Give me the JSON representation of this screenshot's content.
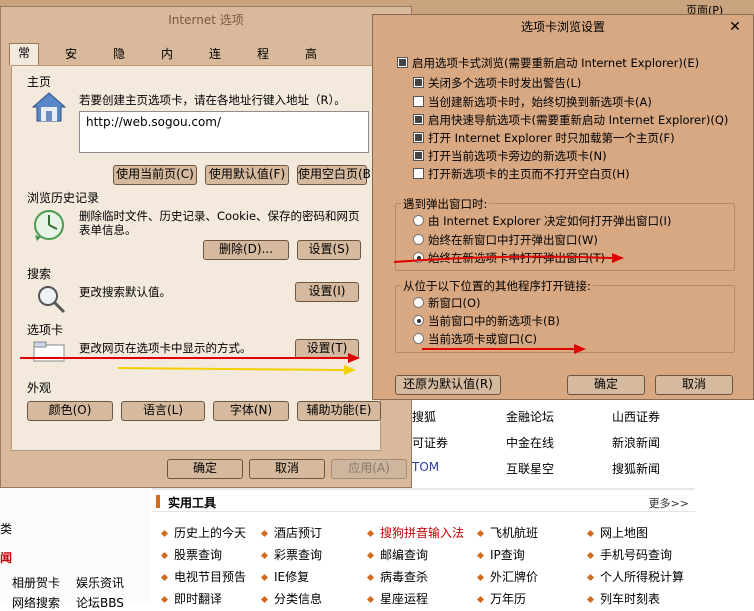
{
  "top_bar": {
    "page_label": "页面(P)"
  },
  "bg_links": {
    "row1": [
      "搜狐",
      "金融论坛",
      "山西证券"
    ],
    "row2": [
      "可证券",
      "中金在线",
      "新浪新闻"
    ],
    "row3": [
      "TOM",
      "互联星空",
      "搜狐新闻"
    ],
    "tools_title": "实用工具",
    "tools_more": "更多>>",
    "tools": [
      [
        "历史上的今天",
        "酒店预订",
        "搜狗拼音输入法",
        "飞机航班",
        "网上地图"
      ],
      [
        "股票查询",
        "彩票查询",
        "邮编查询",
        "IP查询",
        "手机号码查询"
      ],
      [
        "电视节目预告",
        "IE修复",
        "病毒查杀",
        "外汇牌价",
        "个人所得税计算"
      ],
      [
        "即时翻译",
        "分类信息",
        "星座运程",
        "万年历",
        "列车时刻表"
      ]
    ],
    "left_items": [
      "类",
      "闻",
      "相册贺卡",
      "娱乐资讯",
      "网络搜索",
      "论坛BBS"
    ]
  },
  "internet_options": {
    "title": "Internet 选项",
    "tabs": [
      "常规",
      "安全",
      "隐私",
      "内容",
      "连接",
      "程序",
      "高级"
    ],
    "home": {
      "label": "主页",
      "hint": "若要创建主页选项卡，请在各地址行键入地址（R）。",
      "url": "http://web.sogou.com/",
      "btn_current": "使用当前页(C)",
      "btn_default": "使用默认值(F)",
      "btn_blank": "使用空白页(B)"
    },
    "history": {
      "label": "浏览历史记录",
      "text": "删除临时文件、历史记录、Cookie、保存的密码和网页表单信息。",
      "btn_delete": "删除(D)...",
      "btn_settings": "设置(S)"
    },
    "search": {
      "label": "搜索",
      "text": "更改搜索默认值。",
      "btn_settings": "设置(I)"
    },
    "tabs_section": {
      "label": "选项卡",
      "text": "更改网页在选项卡中显示的方式。",
      "btn_settings": "设置(T)"
    },
    "appearance": {
      "label": "外观",
      "btn_colors": "颜色(O)",
      "btn_languages": "语言(L)",
      "btn_fonts": "字体(N)",
      "btn_accessibility": "辅助功能(E)"
    },
    "ok": "确定",
    "cancel": "取消",
    "apply": "应用(A)"
  },
  "tab_settings": {
    "title": "选项卡浏览设置",
    "close": "✕",
    "enable": "启用选项卡式浏览(需要重新启动 Internet Explorer)(E)",
    "options": [
      {
        "label": "关闭多个选项卡时发出警告(L)",
        "checked": true
      },
      {
        "label": "当创建新选项卡时，始终切换到新选项卡(A)",
        "checked": false
      },
      {
        "label": "启用快速导航选项卡(需要重新启动 Internet Explorer)(Q)",
        "checked": true
      },
      {
        "label": "打开 Internet Explorer 时只加载第一个主页(F)",
        "checked": true
      },
      {
        "label": "打开当前选项卡旁边的新选项卡(N)",
        "checked": true
      },
      {
        "label": "打开新选项卡的主页而不打开空白页(H)",
        "checked": false
      }
    ],
    "popup_group": "遇到弹出窗口时:",
    "popup_options": [
      {
        "label": "由 Internet Explorer 决定如何打开弹出窗口(I)",
        "selected": false
      },
      {
        "label": "始终在新窗口中打开弹出窗口(W)",
        "selected": false
      },
      {
        "label": "始终在新选项卡中打开弹出窗口(T)",
        "selected": true
      }
    ],
    "links_group": "从位于以下位置的其他程序打开链接:",
    "links_options": [
      {
        "label": "新窗口(O)",
        "selected": false
      },
      {
        "label": "当前窗口中的新选项卡(B)",
        "selected": true
      },
      {
        "label": "当前选项卡或窗口(C)",
        "selected": false
      }
    ],
    "restore": "还原为默认值(R)",
    "ok": "确定",
    "cancel": "取消"
  }
}
